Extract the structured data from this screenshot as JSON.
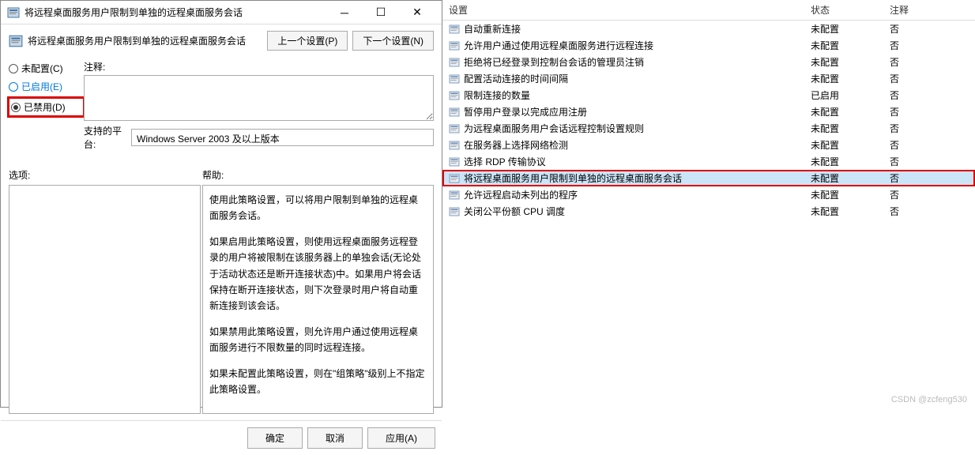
{
  "dialog": {
    "title": "将远程桌面服务用户限制到单独的远程桌面服务会话",
    "policy_title": "将远程桌面服务用户限制到单独的远程桌面服务会话",
    "prev_btn": "上一个设置(P)",
    "next_btn": "下一个设置(N)",
    "radio_not_configured": "未配置(C)",
    "radio_enabled": "已启用(E)",
    "radio_disabled": "已禁用(D)",
    "comment_label": "注释:",
    "platform_label": "支持的平台:",
    "platform_value": "Windows Server 2003 及以上版本",
    "options_label": "选项:",
    "help_label": "帮助:",
    "help_p1": "使用此策略设置，可以将用户限制到单独的远程桌面服务会话。",
    "help_p2": "如果启用此策略设置，则使用远程桌面服务远程登录的用户将被限制在该服务器上的单独会话(无论处于活动状态还是断开连接状态)中。如果用户将会话保持在断开连接状态，则下次登录时用户将自动重新连接到该会话。",
    "help_p3": "如果禁用此策略设置，则允许用户通过使用远程桌面服务进行不限数量的同时远程连接。",
    "help_p4": "如果未配置此策略设置，则在\"组策略\"级别上不指定此策略设置。",
    "ok_btn": "确定",
    "cancel_btn": "取消",
    "apply_btn": "应用(A)"
  },
  "list": {
    "header_setting": "设置",
    "header_state": "状态",
    "header_comment": "注释",
    "rows": [
      {
        "name": "自动重新连接",
        "state": "未配置",
        "comment": "否"
      },
      {
        "name": "允许用户通过使用远程桌面服务进行远程连接",
        "state": "未配置",
        "comment": "否"
      },
      {
        "name": "拒绝将已经登录到控制台会话的管理员注销",
        "state": "未配置",
        "comment": "否"
      },
      {
        "name": "配置活动连接的时间间隔",
        "state": "未配置",
        "comment": "否"
      },
      {
        "name": "限制连接的数量",
        "state": "已启用",
        "comment": "否"
      },
      {
        "name": "暂停用户登录以完成应用注册",
        "state": "未配置",
        "comment": "否"
      },
      {
        "name": "为远程桌面服务用户会话远程控制设置规则",
        "state": "未配置",
        "comment": "否"
      },
      {
        "name": "在服务器上选择网络检测",
        "state": "未配置",
        "comment": "否"
      },
      {
        "name": "选择 RDP 传输协议",
        "state": "未配置",
        "comment": "否"
      },
      {
        "name": "将远程桌面服务用户限制到单独的远程桌面服务会话",
        "state": "未配置",
        "comment": "否"
      },
      {
        "name": "允许远程启动未列出的程序",
        "state": "未配置",
        "comment": "否"
      },
      {
        "name": "关闭公平份额 CPU 调度",
        "state": "未配置",
        "comment": "否"
      }
    ]
  },
  "watermark": "CSDN @zcfeng530"
}
